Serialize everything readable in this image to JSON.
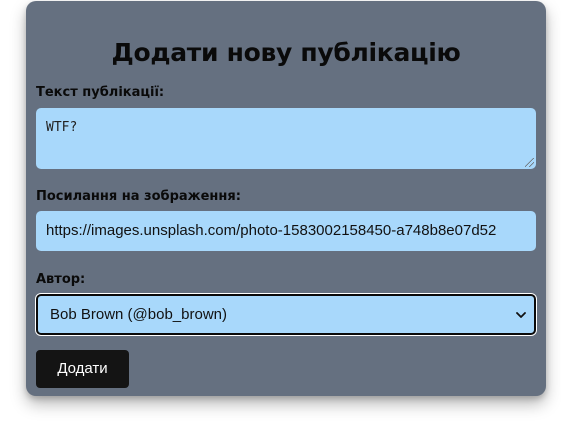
{
  "form": {
    "title": "Додати нову публікацію",
    "text_label": "Текст публікації:",
    "text_value": "WTF?",
    "image_label": "Посилання на зображення:",
    "image_value": "https://images.unsplash.com/photo-1583002158450-a748b8e07d52",
    "author_label": "Автор:",
    "author_selected": "Bob Brown (@bob_brown)",
    "submit_label": "Додати"
  },
  "icons": {
    "select_arrow": "chevron-down-icon",
    "resize_handle": "resize-grip-icon"
  },
  "colors": {
    "card_background": "#657080",
    "field_background": "#a8d8fb",
    "button_background": "#141414"
  }
}
